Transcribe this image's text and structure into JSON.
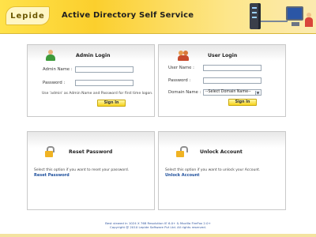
{
  "header": {
    "logo_text": "Lepide",
    "title": "Active Directory Self Service"
  },
  "admin_login": {
    "title": "Admin Login",
    "admin_name_label": "Admin Name :",
    "admin_name_value": "",
    "password_label": "Password    :",
    "password_value": "",
    "hint": "Use 'admin' as Admin Name and Password for first time logon.",
    "signin_label": "Sign In"
  },
  "user_login": {
    "title": "User Login",
    "user_name_label": "User Name :",
    "user_name_value": "",
    "password_label": "Password    :",
    "password_value": "",
    "domain_label": "Domain Name :",
    "domain_selected": "--Select Domain Name--",
    "signin_label": "Sign In"
  },
  "reset_password": {
    "title": "Reset Password",
    "description": "Select this option if you want to reset your password.",
    "link": "Reset Password"
  },
  "unlock_account": {
    "title": "Unlock Account",
    "description": "Select this option if you want to unlock your Account.",
    "link": "Unlock Account"
  },
  "footer": {
    "line1": "Best viewed in 1024 X 768 Resolution IE 6.0+ & Mozilla FireFox 2.0+",
    "line2": "Copyright @ 2010 Lepide Software Pvt Ltd. All rights reserved."
  },
  "icons": {
    "admin": "admin-user-icon",
    "user": "user-group-icon",
    "reset": "lock-icon",
    "unlock": "unlock-icon"
  },
  "colors": {
    "header_yellow": "#fbcf2d",
    "button_yellow": "#f6d21c",
    "link_blue": "#1c4e9c"
  }
}
